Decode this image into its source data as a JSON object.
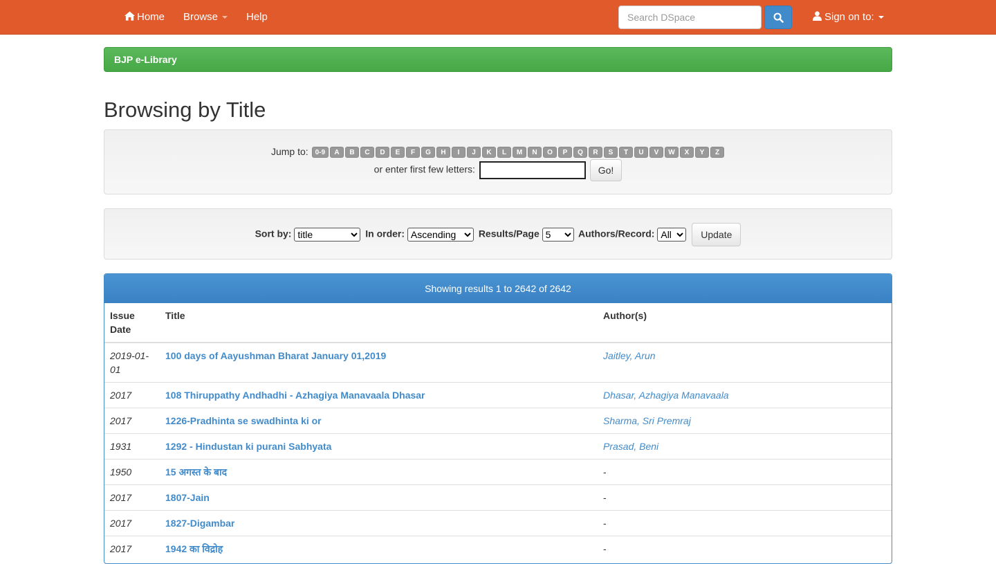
{
  "navbar": {
    "home_label": "Home",
    "browse_label": "Browse",
    "help_label": "Help",
    "search_placeholder": "Search DSpace",
    "signon_label": "Sign on to:",
    "bg_color": "#e05a2b"
  },
  "breadcrumb": {
    "label": "BJP e-Library"
  },
  "page_title": "Browsing by Title",
  "jump": {
    "label": "Jump to:",
    "letters": [
      "0-9",
      "A",
      "B",
      "C",
      "D",
      "E",
      "F",
      "G",
      "H",
      "I",
      "J",
      "K",
      "L",
      "M",
      "N",
      "O",
      "P",
      "Q",
      "R",
      "S",
      "T",
      "U",
      "V",
      "W",
      "X",
      "Y",
      "Z"
    ],
    "enter_label": "or enter first few letters:",
    "go_label": "Go!"
  },
  "sort": {
    "sort_by_label": "Sort by:",
    "sort_by_value": "title",
    "order_label": "In order:",
    "order_value": "Ascending",
    "rpp_label": "Results/Page",
    "rpp_value": "5",
    "authors_label": "Authors/Record:",
    "authors_value": "All",
    "update_label": "Update"
  },
  "results": {
    "heading": "Showing results 1 to 2642 of 2642",
    "columns": {
      "date": "Issue Date",
      "title": "Title",
      "authors": "Author(s)"
    },
    "rows": [
      {
        "date": "2019-01-01",
        "title": "100 days of Aayushman Bharat January 01,2019",
        "author": "Jaitley, Arun"
      },
      {
        "date": "2017",
        "title": "108 Thiruppathy Andhadhi - Azhagiya Manavaala Dhasar",
        "author": "Dhasar, Azhagiya Manavaala"
      },
      {
        "date": "2017",
        "title": "1226-Pradhinta se swadhinta ki or",
        "author": "Sharma, Sri Premraj"
      },
      {
        "date": "1931",
        "title": "1292 - Hindustan ki purani Sabhyata",
        "author": "Prasad, Beni"
      },
      {
        "date": "1950",
        "title": "15 अगस्त के बाद",
        "author": "-"
      },
      {
        "date": "2017",
        "title": "1807-Jain",
        "author": "-"
      },
      {
        "date": "2017",
        "title": "1827-Digambar",
        "author": "-"
      },
      {
        "date": "2017",
        "title": "1942 का विद्रोह",
        "author": "-"
      }
    ]
  }
}
